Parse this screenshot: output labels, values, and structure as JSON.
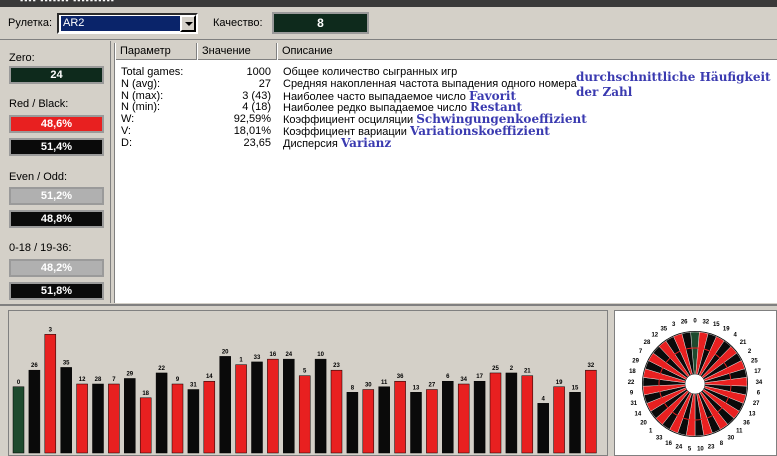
{
  "toolbar": {
    "roulette_label": "Рулетка:",
    "roulette_value": "AR2",
    "quality_label": "Качество:",
    "quality_value": "8"
  },
  "left_panel": {
    "zero_label": "Zero:",
    "zero_value": "24",
    "red_black_label": "Red / Black:",
    "red_value": "48,6%",
    "black_value": "51,4%",
    "even_odd_label": "Even / Odd:",
    "even_value": "51,2%",
    "odd_value": "48,8%",
    "low_high_label": "0-18 / 19-36:",
    "low_value": "48,2%",
    "high_value": "51,8%"
  },
  "table": {
    "headers": [
      "Параметр",
      "Значение",
      "Описание"
    ],
    "rows": [
      {
        "param": "Total games:",
        "value": "1000",
        "desc": "Общее количество сыгранных игр",
        "note": ""
      },
      {
        "param": "N (avg):",
        "value": "27",
        "desc": "Средняя накопленная частота выпадения одного номера",
        "note": ""
      },
      {
        "param": "N (max):",
        "value": "3 (43)",
        "desc": "Наиболее часто выпадаемое число",
        "note": "Favorit"
      },
      {
        "param": "N (min):",
        "value": "4 (18)",
        "desc": "Наиболее редко выпадаемое число",
        "note": "Restant"
      },
      {
        "param": "W:",
        "value": "92,59%",
        "desc": "Коэффициент осциляции",
        "note": "Schwingungenkoeffizient"
      },
      {
        "param": "V:",
        "value": "18,01%",
        "desc": "Коэффициент вариации",
        "note": "Variationskoeffizient"
      },
      {
        "param": "D:",
        "value": "23,65",
        "desc": "Дисперсия",
        "note": "Varianz"
      }
    ],
    "avg_note_line1": "durchschnittliche Häufigkeit",
    "avg_note_line2": "der Zahl"
  },
  "colors": {
    "red": "#e82020",
    "black": "#0a0a0a",
    "zero_green": "#1e4a2e",
    "selection": "#0a246a"
  },
  "chart_data": {
    "type": "bar",
    "ylim": [
      0,
      50
    ],
    "bars": [
      {
        "label": "0",
        "value": 24,
        "color": "green"
      },
      {
        "label": "26",
        "value": 30,
        "color": "black"
      },
      {
        "label": "3",
        "value": 43,
        "color": "red"
      },
      {
        "label": "35",
        "value": 31,
        "color": "black"
      },
      {
        "label": "12",
        "value": 25,
        "color": "red"
      },
      {
        "label": "28",
        "value": 25,
        "color": "black"
      },
      {
        "label": "7",
        "value": 25,
        "color": "red"
      },
      {
        "label": "29",
        "value": 27,
        "color": "black"
      },
      {
        "label": "18",
        "value": 20,
        "color": "red"
      },
      {
        "label": "22",
        "value": 29,
        "color": "black"
      },
      {
        "label": "9",
        "value": 25,
        "color": "red"
      },
      {
        "label": "31",
        "value": 23,
        "color": "black"
      },
      {
        "label": "14",
        "value": 26,
        "color": "red"
      },
      {
        "label": "20",
        "value": 35,
        "color": "black"
      },
      {
        "label": "1",
        "value": 32,
        "color": "red"
      },
      {
        "label": "33",
        "value": 33,
        "color": "black"
      },
      {
        "label": "16",
        "value": 34,
        "color": "red"
      },
      {
        "label": "24",
        "value": 34,
        "color": "black"
      },
      {
        "label": "5",
        "value": 28,
        "color": "red"
      },
      {
        "label": "10",
        "value": 34,
        "color": "black"
      },
      {
        "label": "23",
        "value": 30,
        "color": "red"
      },
      {
        "label": "8",
        "value": 22,
        "color": "black"
      },
      {
        "label": "30",
        "value": 23,
        "color": "red"
      },
      {
        "label": "11",
        "value": 24,
        "color": "black"
      },
      {
        "label": "36",
        "value": 26,
        "color": "red"
      },
      {
        "label": "13",
        "value": 22,
        "color": "black"
      },
      {
        "label": "27",
        "value": 23,
        "color": "red"
      },
      {
        "label": "6",
        "value": 26,
        "color": "black"
      },
      {
        "label": "34",
        "value": 25,
        "color": "red"
      },
      {
        "label": "17",
        "value": 26,
        "color": "black"
      },
      {
        "label": "25",
        "value": 29,
        "color": "red"
      },
      {
        "label": "2",
        "value": 29,
        "color": "black"
      },
      {
        "label": "21",
        "value": 28,
        "color": "red"
      },
      {
        "label": "4",
        "value": 18,
        "color": "black"
      },
      {
        "label": "19",
        "value": 24,
        "color": "red"
      },
      {
        "label": "15",
        "value": 22,
        "color": "black"
      },
      {
        "label": "32",
        "value": 30,
        "color": "red"
      }
    ]
  },
  "wheel": {
    "numbers": [
      "0",
      "32",
      "15",
      "19",
      "4",
      "21",
      "2",
      "25",
      "17",
      "34",
      "6",
      "27",
      "13",
      "36",
      "11",
      "30",
      "8",
      "23",
      "10",
      "5",
      "24",
      "16",
      "33",
      "1",
      "20",
      "14",
      "31",
      "9",
      "22",
      "18",
      "29",
      "7",
      "28",
      "12",
      "35",
      "3",
      "26"
    ]
  }
}
